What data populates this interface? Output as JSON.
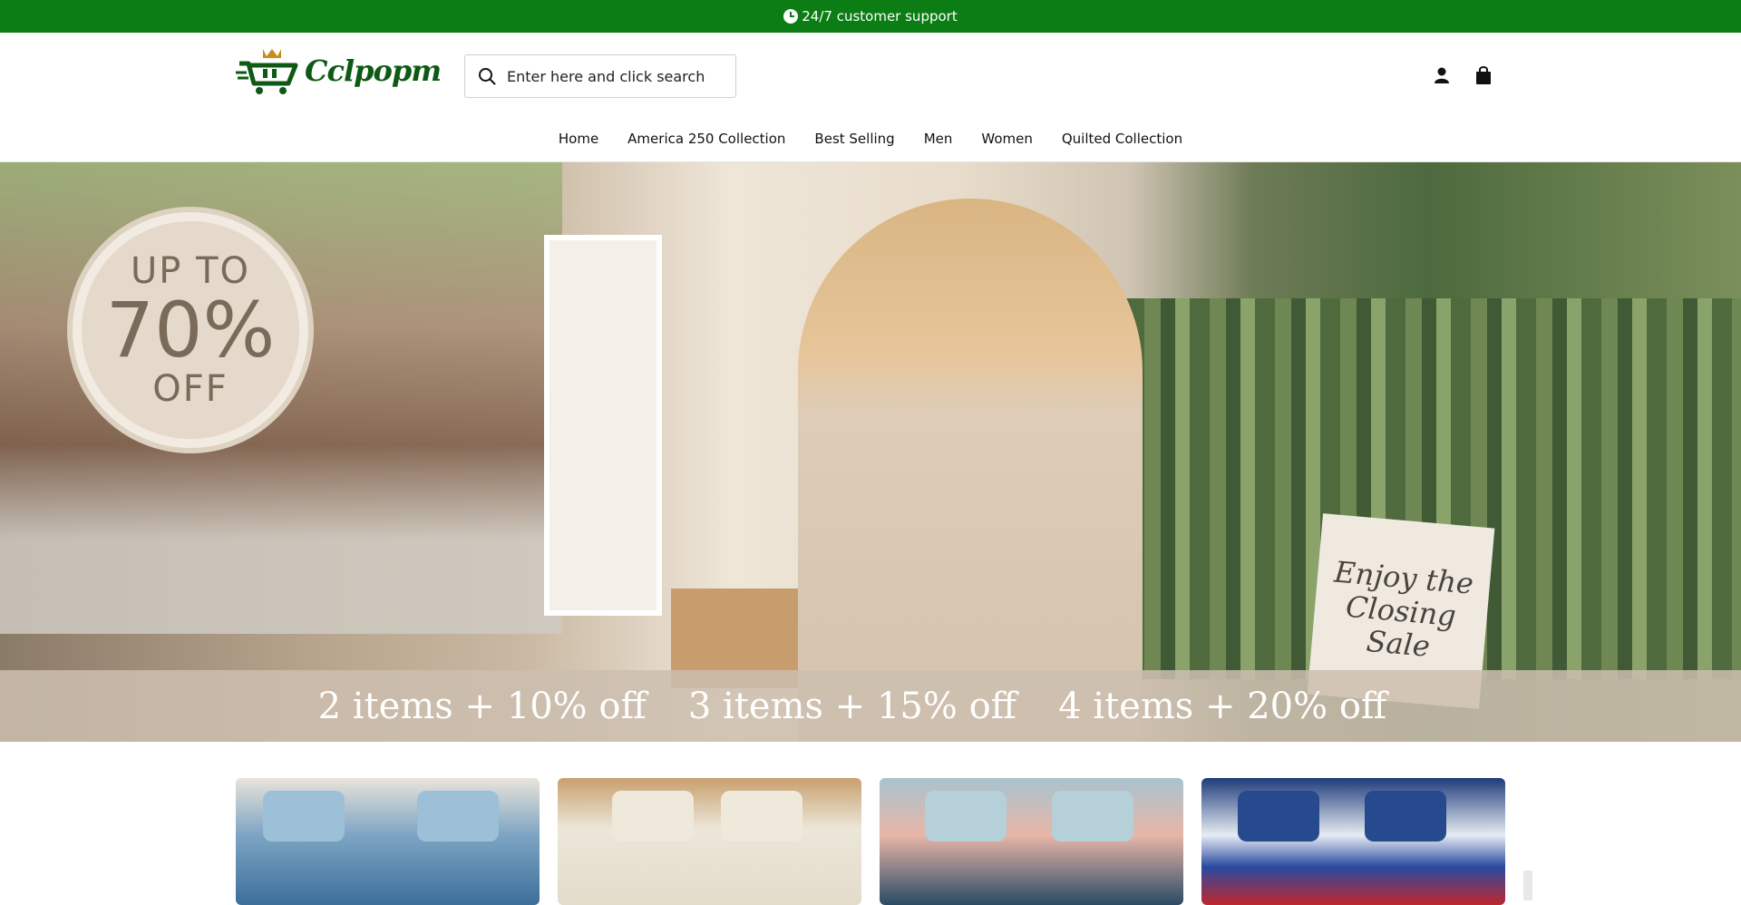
{
  "topbar": {
    "support_text": "24/7 customer support",
    "bg_color": "#0b7d14",
    "icon": "clock-icon"
  },
  "header": {
    "logo_text": "Cclpopm",
    "search": {
      "placeholder": "Enter here and click search",
      "icon": "search-icon"
    },
    "icons": [
      "user-icon",
      "shopping-bag-icon"
    ]
  },
  "nav": {
    "items": [
      {
        "label": "Home"
      },
      {
        "label": "America 250 Collection"
      },
      {
        "label": "Best Selling"
      },
      {
        "label": "Men"
      },
      {
        "label": "Women"
      },
      {
        "label": "Quilted Collection"
      }
    ]
  },
  "hero": {
    "badge": {
      "line1": "UP TO",
      "line2": "70%",
      "line3": "OFF"
    },
    "sign_text": "Enjoy the Closing Sale",
    "offers": [
      "2 items + 10% off",
      "3 items + 15% off",
      "4 items + 20% off"
    ]
  },
  "products": {
    "items": [
      {
        "theme": "sea-turtle-quilt"
      },
      {
        "theme": "floral-books-quilt"
      },
      {
        "theme": "floral-quilt"
      },
      {
        "theme": "american-flag-quilt"
      }
    ]
  }
}
